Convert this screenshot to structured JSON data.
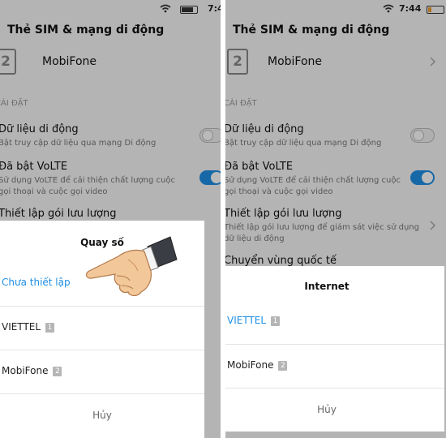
{
  "status": {
    "time": "7:44"
  },
  "header": {
    "title": "Thẻ SIM & mạng di động"
  },
  "sim": {
    "slot_number": "2",
    "carrier_name": "MobiFone"
  },
  "settings": {
    "section_label": "CÀI ĐẶT",
    "mobile_data": {
      "title": "Dữ liệu di động",
      "subtitle": "Bật truy cập dữ liệu qua mạng Di động",
      "enabled": false
    },
    "volte": {
      "title": "Đã bật VoLTE",
      "subtitle_line1": "Sử dụng VoLTE để cải thiện chất lượng cuộc",
      "subtitle_line2": "gọi thoại và cuộc gọi video",
      "enabled": true
    },
    "data_plan": {
      "title": "Thiết lập gói lưu lượng",
      "subtitle_line1": "Thiết lập gói lưu lượng để giám sát việc sử dụng",
      "subtitle_line2": "dữ liệu di động"
    },
    "roaming": {
      "title": "Chuyển vùng quốc tế"
    }
  },
  "call_dialog": {
    "title": "Quay số",
    "options": [
      {
        "label": "Chưa thiết lập",
        "badge": "",
        "selected": true
      },
      {
        "label": "VIETTEL",
        "badge": "1",
        "selected": false
      },
      {
        "label": "MobiFone",
        "badge": "2",
        "selected": false
      }
    ],
    "cancel_label": "Hủy"
  },
  "internet_dialog": {
    "title": "Internet",
    "options": [
      {
        "label": "VIETTEL",
        "badge": "1",
        "selected": true
      },
      {
        "label": "MobiFone",
        "badge": "2",
        "selected": false
      }
    ],
    "cancel_label": "Hủy"
  },
  "colors": {
    "accent": "#1f8fe5",
    "dim_overlay": "rgba(0,0,0,0.27)",
    "battery_low": "#f29a2e"
  },
  "icons": {
    "wifi": "wifi-icon",
    "battery": "battery-icon",
    "back": "back-arrow-icon",
    "chevron": "chevron-right-icon",
    "sim": "sim-card-icon",
    "hand": "pointing-hand-icon",
    "check": "checkmark-icon"
  }
}
